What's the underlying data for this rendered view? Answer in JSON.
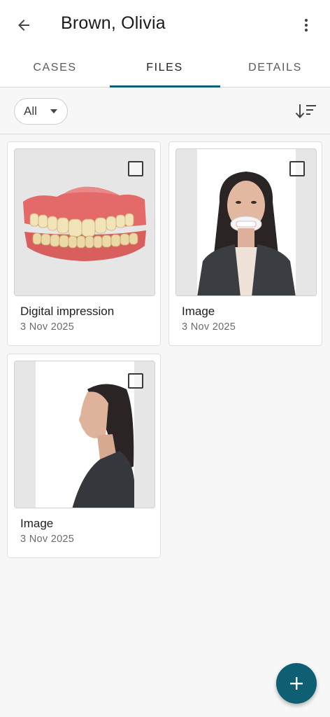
{
  "header": {
    "title": "Brown, Olivia",
    "back_icon": "arrow-left-icon",
    "more_icon": "more-vertical-icon"
  },
  "tabs": [
    {
      "label": "CASES",
      "active": false
    },
    {
      "label": "FILES",
      "active": true
    },
    {
      "label": "DETAILS",
      "active": false
    }
  ],
  "filter": {
    "selected": "All",
    "sort_icon": "sort-icon"
  },
  "files": [
    {
      "title": "Digital impression",
      "date": "3 Nov 2025",
      "kind": "3d-scan",
      "checked": false
    },
    {
      "title": "Image",
      "date": "3 Nov 2025",
      "kind": "photo-frontal-retractor",
      "checked": false
    },
    {
      "title": "Image",
      "date": "3 Nov 2025",
      "kind": "photo-profile",
      "checked": false
    }
  ],
  "fab": {
    "icon": "plus-icon"
  },
  "colors": {
    "accent": "#0f5f74",
    "background": "#f7f7f7"
  }
}
